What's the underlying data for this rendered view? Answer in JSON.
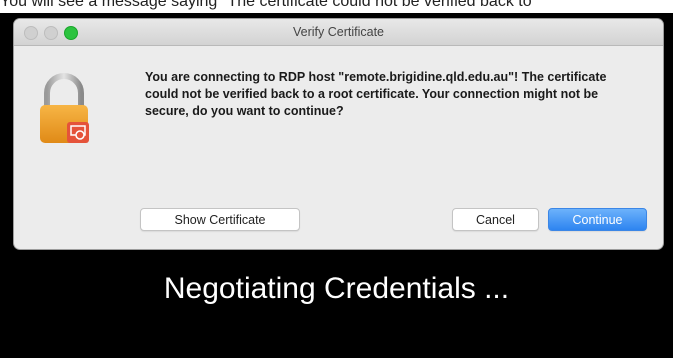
{
  "caption": "You will see a message saying \"The certificate could not be verified back to",
  "dialog": {
    "title": "Verify Certificate",
    "message": "You are connecting to RDP host \"remote.brigidine.qld.edu.au\"! The certificate could not be verified back to a root certificate. Your connection might not be secure, do you want to continue?",
    "icon": "lock-icon",
    "buttons": {
      "show_certificate": "Show Certificate",
      "cancel": "Cancel",
      "continue": "Continue"
    }
  },
  "status": "Negotiating Credentials ...",
  "colors": {
    "accent_button": "#2d84f0",
    "lock_orange": "#f0a12a",
    "badge_red": "#e5533a",
    "background": "#000000"
  }
}
